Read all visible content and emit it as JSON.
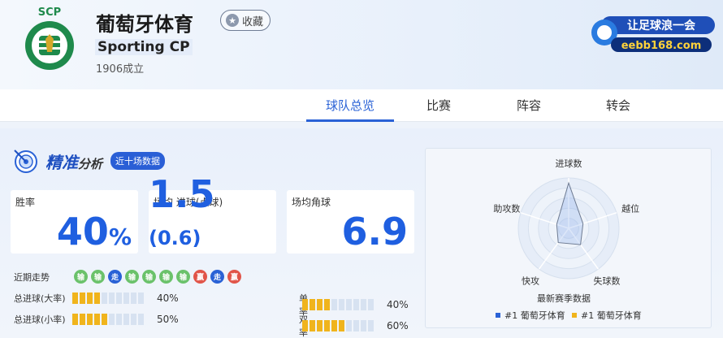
{
  "team": {
    "name": "葡萄牙体育",
    "english_name": "Sporting CP",
    "founded": "1906成立",
    "favorite_label": "收藏",
    "logo_text": "SCP",
    "brand_text": "让足球浪一会",
    "brand_site": "eebb168.com"
  },
  "tabs": [
    {
      "label": "球队总览",
      "active": true
    },
    {
      "label": "比赛",
      "active": false
    },
    {
      "label": "阵容",
      "active": false
    },
    {
      "label": "转会",
      "active": false
    }
  ],
  "analysis": {
    "title_main": "精准",
    "title_sub": "分析",
    "pill": "近十场数据"
  },
  "cards": [
    {
      "label": "胜率",
      "value": "40",
      "suffix": "%"
    },
    {
      "label": "场均 进球(点球)",
      "value": "1.5",
      "suffix": "(0.6)"
    },
    {
      "label": "场均角球",
      "value": "6.9",
      "suffix": ""
    }
  ],
  "trend": {
    "label": "近期走势",
    "results": [
      "输",
      "输",
      "走",
      "输",
      "输",
      "输",
      "输",
      "赢",
      "走",
      "赢"
    ]
  },
  "stats": [
    {
      "label": "总进球(大率)",
      "filled": 4,
      "total": 10,
      "pct": "40%"
    },
    {
      "label": "单率",
      "filled": 4,
      "total": 10,
      "pct": "40%"
    },
    {
      "label": "总进球(小率)",
      "filled": 5,
      "total": 10,
      "pct": "50%"
    },
    {
      "label": "双率",
      "filled": 6,
      "total": 10,
      "pct": "60%"
    }
  ],
  "radar": {
    "axes": [
      "进球数",
      "越位",
      "失球数",
      "快攻",
      "助攻数"
    ],
    "values": [
      0.9,
      0.3,
      0.4,
      0.35,
      0.25
    ],
    "caption": "最新赛季数据",
    "legend": [
      {
        "label": "#1 葡萄牙体育",
        "color": "#2a62d6"
      },
      {
        "label": "#1 葡萄牙体育",
        "color": "#f0b41c"
      }
    ]
  }
}
